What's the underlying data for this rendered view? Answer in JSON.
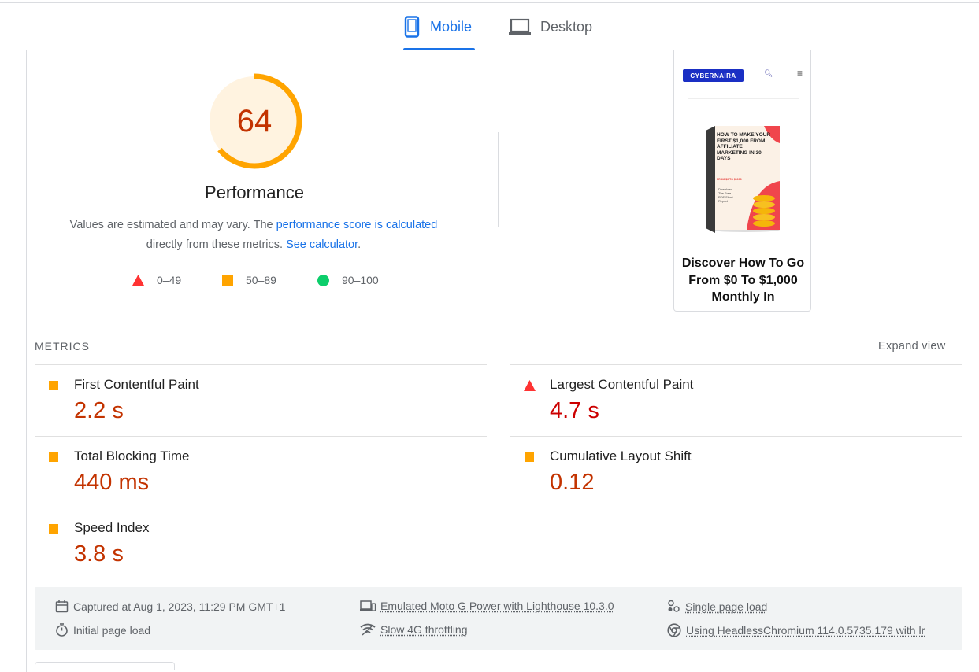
{
  "tabs": [
    {
      "label": "Mobile",
      "icon": "smartphone-icon",
      "selected": true
    },
    {
      "label": "Desktop",
      "icon": "laptop-icon",
      "selected": false
    }
  ],
  "score": {
    "value": "64",
    "fraction": 0.64,
    "title": "Performance",
    "color": "#ffa400",
    "text_color": "#c33300",
    "background": "#fff3e0"
  },
  "description": {
    "part1": "Values are estimated and may vary. The ",
    "link1": "performance score is calculated",
    "part2": " directly from these metrics. ",
    "link2": "See calculator",
    "part3": "."
  },
  "legend": [
    {
      "label": "0–49",
      "icon": "red-triangle-icon",
      "color": "#ff3333"
    },
    {
      "label": "50–89",
      "icon": "orange-square-icon",
      "color": "#ffa400"
    },
    {
      "label": "90–100",
      "icon": "green-circle-icon",
      "color": "#0cce6b"
    }
  ],
  "thumbnail": {
    "logo": "CYBERNAIRA",
    "headline": "Discover How To Go From $0 To $1,000 Monthly In",
    "book_title": "HOW TO MAKE YOUR FIRST $1,000 FROM AFFILIATE MARKETING IN 30 DAYS",
    "book_sub": "FROM $0 TO $1000",
    "book_note": "Download The Free PDF Short Report"
  },
  "metrics": {
    "section_label": "METRICS",
    "expand_label": "Expand view",
    "items": [
      {
        "name": "First Contentful Paint",
        "value": "2.2 s",
        "status": "average"
      },
      {
        "name": "Largest Contentful Paint",
        "value": "4.7 s",
        "status": "fail"
      },
      {
        "name": "Total Blocking Time",
        "value": "440 ms",
        "status": "average"
      },
      {
        "name": "Cumulative Layout Shift",
        "value": "0.12",
        "status": "average"
      },
      {
        "name": "Speed Index",
        "value": "3.8 s",
        "status": "average"
      }
    ]
  },
  "footer": {
    "captured": "Captured at Aug 1, 2023, 11:29 PM GMT+1",
    "initial_load": "Initial page load",
    "emulated": "Emulated Moto G Power with Lighthouse 10.3.0",
    "throttling": "Slow 4G throttling",
    "single_load": "Single page load",
    "browser": "Using HeadlessChromium 114.0.5735.179 with lr"
  }
}
